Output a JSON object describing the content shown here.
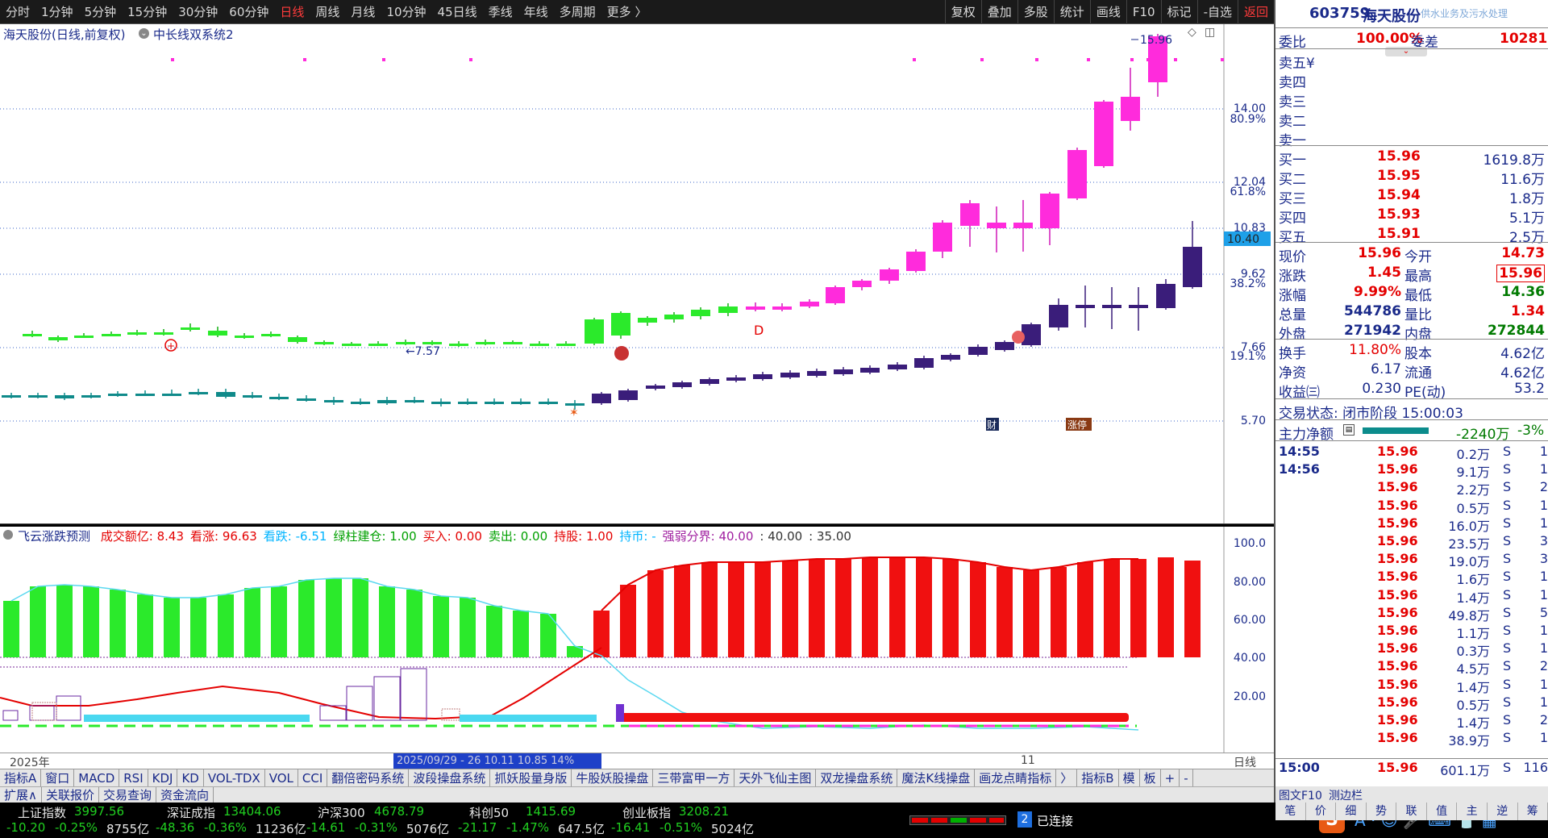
{
  "period_tabs": [
    "分时",
    "1分钟",
    "5分钟",
    "15分钟",
    "30分钟",
    "60分钟",
    "日线",
    "周线",
    "月线",
    "10分钟",
    "45日线",
    "季线",
    "年线",
    "多周期",
    "更多 〉"
  ],
  "tool_buttons": [
    "复权",
    "叠加",
    "多股",
    "统计",
    "画线",
    "F10",
    "标记",
    "-自选",
    "返回"
  ],
  "main_chart": {
    "title": "海天股份(日线,前复权)",
    "indicator": "中长线双系统2",
    "price_labels": [
      "14.00",
      "12.04",
      "10.83",
      "9.62",
      "7.66",
      "5.70"
    ],
    "pct_labels": [
      "80.9%",
      "61.8%",
      "38.2%",
      "19.1%"
    ],
    "current_price_tag": "10.40",
    "high_marker": "15.96",
    "low_marker": "←7.57",
    "d_marker": "D",
    "badge_cai": "财",
    "badge_zt": "涨停"
  },
  "indicator_chart": {
    "title": "飞云涨跌预测",
    "values_line": [
      {
        "label": "成交额亿: 8.43",
        "color": "#e40000"
      },
      {
        "label": "看涨: 96.63",
        "color": "#e40000"
      },
      {
        "label": "看跌: -6.51",
        "color": "#00b4ff"
      },
      {
        "label": "绿柱建仓: 1.00",
        "color": "#00a000"
      },
      {
        "label": "买入: 0.00",
        "color": "#e40000"
      },
      {
        "label": "卖出: 0.00",
        "color": "#00a000"
      },
      {
        "label": "持股: 1.00",
        "color": "#e40000"
      },
      {
        "label": "持币: -",
        "color": "#00b4ff"
      },
      {
        "label": "强弱分界: 40.00",
        "color": "#a020a0"
      },
      {
        "label": ": 40.00",
        "color": "#333333"
      },
      {
        "label": ": 35.00",
        "color": "#333333"
      }
    ],
    "axis_labels": [
      "100.0",
      "80.00",
      "60.00",
      "40.00",
      "20.00"
    ]
  },
  "date_axis": {
    "year": "2025年",
    "cursor_date": "2025/09/29",
    "cursor_extra": "- 26 10.11 10.85 14%",
    "month_label": "11",
    "period": "日线"
  },
  "indicator_tabs": [
    "指标A",
    "窗口",
    "MACD",
    "RSI",
    "KDJ",
    "KD",
    "VOL-TDX",
    "VOL",
    "CCI",
    "翻倍密码系统",
    "波段操盘系统",
    "抓妖股量身版",
    "牛股妖股操盘",
    "三带富甲一方",
    "天外飞仙主图",
    "双龙操盘系统",
    "魔法K线操盘",
    "画龙点睛指标",
    "〉",
    "指标B",
    "模",
    "板",
    "+",
    "-"
  ],
  "sub_tabs": [
    "扩展∧",
    "关联报价",
    "交易查询",
    "资金流向"
  ],
  "status_bar": {
    "indices": [
      {
        "name": "上证指数",
        "value": "3997.56",
        "chg": "-10.20",
        "pct": "-0.25%",
        "amt": "8755亿"
      },
      {
        "name": "深证成指",
        "value": "13404.06",
        "chg": "-48.36",
        "pct": "-0.36%",
        "amt": "11236亿"
      },
      {
        "name": "沪深300",
        "value": "4678.79",
        "chg": "-14.61",
        "pct": "-0.31%",
        "amt": "5076亿"
      },
      {
        "name": "科创50",
        "value": "1415.69",
        "chg": "-21.17",
        "pct": "-1.47%",
        "amt": "647.5亿"
      },
      {
        "name": "创业板指",
        "value": "3208.21",
        "chg": "-16.41",
        "pct": "-0.51%",
        "amt": "5024亿"
      }
    ],
    "conn_count": "2",
    "conn_text": "已连接"
  },
  "right_panel": {
    "code": "603759",
    "name": "海天股份",
    "subtitle": "供水业务及污水处理",
    "weibi_label": "委比",
    "weibi": "100.00%",
    "weicha_label": "委差",
    "weicha": "10281",
    "sell": [
      {
        "label": "卖五¥",
        "price": "",
        "vol": ""
      },
      {
        "label": "卖四",
        "price": "",
        "vol": ""
      },
      {
        "label": "卖三",
        "price": "",
        "vol": ""
      },
      {
        "label": "卖二",
        "price": "",
        "vol": ""
      },
      {
        "label": "卖一",
        "price": "",
        "vol": ""
      }
    ],
    "buy": [
      {
        "label": "买一",
        "price": "15.96",
        "vol": "1619.8万"
      },
      {
        "label": "买二",
        "price": "15.95",
        "vol": "11.6万"
      },
      {
        "label": "买三",
        "price": "15.94",
        "vol": "1.8万"
      },
      {
        "label": "买四",
        "price": "15.93",
        "vol": "5.1万"
      },
      {
        "label": "买五",
        "price": "15.91",
        "vol": "2.5万"
      }
    ],
    "quote": [
      {
        "l1": "现价",
        "v1": "15.96",
        "l2": "今开",
        "v2": "14.73"
      },
      {
        "l1": "涨跌",
        "v1": "1.45",
        "l2": "最高",
        "v2": "15.96"
      },
      {
        "l1": "涨幅",
        "v1": "9.99%",
        "l2": "最低",
        "v2": "14.36"
      },
      {
        "l1": "总量",
        "v1": "544786",
        "l2": "量比",
        "v2": "1.34"
      },
      {
        "l1": "外盘",
        "v1": "271942",
        "l2": "内盘",
        "v2": "272844"
      }
    ],
    "fund": [
      {
        "l1": "换手",
        "v1": "11.80%",
        "l2": "股本",
        "v2": "4.62亿"
      },
      {
        "l1": "净资",
        "v1": "6.17",
        "l2": "流通",
        "v2": "4.62亿"
      },
      {
        "l1": "收益㈢",
        "v1": "0.230",
        "l2": "PE(动)",
        "v2": "53.2"
      }
    ],
    "trade_status": "交易状态: 闭市阶段 15:00:03",
    "main_net_label": "主力净额",
    "main_net": "-2240万",
    "main_net_pct": "-3%",
    "ticks": [
      {
        "t": "14:55",
        "p": "15.96",
        "v": "0.2万",
        "s": "S",
        "n": "1"
      },
      {
        "t": "14:56",
        "p": "15.96",
        "v": "9.1万",
        "s": "S",
        "n": "1"
      },
      {
        "t": "",
        "p": "15.96",
        "v": "2.2万",
        "s": "S",
        "n": "2"
      },
      {
        "t": "",
        "p": "15.96",
        "v": "0.5万",
        "s": "S",
        "n": "1"
      },
      {
        "t": "",
        "p": "15.96",
        "v": "16.0万",
        "s": "S",
        "n": "1"
      },
      {
        "t": "",
        "p": "15.96",
        "v": "23.5万",
        "s": "S",
        "n": "3"
      },
      {
        "t": "",
        "p": "15.96",
        "v": "19.0万",
        "s": "S",
        "n": "3"
      },
      {
        "t": "",
        "p": "15.96",
        "v": "1.6万",
        "s": "S",
        "n": "1"
      },
      {
        "t": "",
        "p": "15.96",
        "v": "1.4万",
        "s": "S",
        "n": "1"
      },
      {
        "t": "",
        "p": "15.96",
        "v": "49.8万",
        "s": "S",
        "n": "5"
      },
      {
        "t": "",
        "p": "15.96",
        "v": "1.1万",
        "s": "S",
        "n": "1"
      },
      {
        "t": "",
        "p": "15.96",
        "v": "0.3万",
        "s": "S",
        "n": "1"
      },
      {
        "t": "",
        "p": "15.96",
        "v": "4.5万",
        "s": "S",
        "n": "2"
      },
      {
        "t": "",
        "p": "15.96",
        "v": "1.4万",
        "s": "S",
        "n": "1"
      },
      {
        "t": "",
        "p": "15.96",
        "v": "0.5万",
        "s": "S",
        "n": "1"
      },
      {
        "t": "",
        "p": "15.96",
        "v": "1.4万",
        "s": "S",
        "n": "2"
      },
      {
        "t": "",
        "p": "15.96",
        "v": "38.9万",
        "s": "S",
        "n": "1"
      },
      {
        "t": "15:00",
        "p": "15.96",
        "v": "601.1万",
        "s": "S",
        "n": "116"
      }
    ],
    "bottom_tabs": [
      "笔",
      "价",
      "细",
      "势",
      "联",
      "值",
      "主",
      "逆",
      "筹"
    ],
    "f10_label": "图文F10",
    "side_label": "测边栏"
  },
  "colors": {
    "up": "#e40000",
    "down": "#007a00",
    "magenta": "#ff2bdc",
    "green_candle": "#2bea2b",
    "purple": "#3a1d7a",
    "teal": "#0f8a8a"
  }
}
